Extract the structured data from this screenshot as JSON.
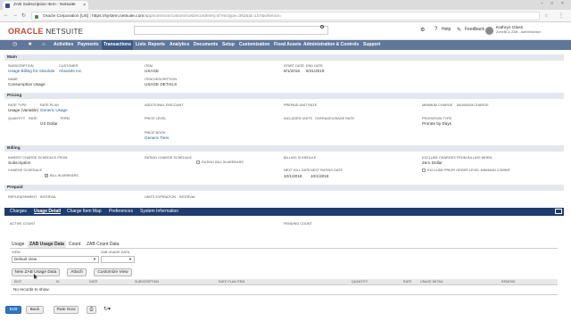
{
  "browser": {
    "tab_title": "ZAB Subscription Item - Netsuite",
    "tab_close": "×",
    "window_min": "–",
    "window_max": "□",
    "window_close": "×",
    "back": "←",
    "forward": "→",
    "reload": "↻",
    "url_org": "Oracle Corporation [US]",
    "url_sep": "|",
    "url_host": "https://system.netsuite.com",
    "url_path": "/app/common/custom/custrecordentry.nl?rectype=362&id=107&whence="
  },
  "header": {
    "logo_main": "ORACLE",
    "logo_sub": " NETSUITE",
    "help": "Help",
    "feedback": "Feedback",
    "user_name": "Kathryn Glass",
    "user_role": "ZoneBCo ZAB - Administrator"
  },
  "topnav": [
    "Activities",
    "Payments",
    "Transactions",
    "Lists",
    "Reports",
    "Analytics",
    "Documents",
    "Setup",
    "Customization",
    "Fixed Assets",
    "Administration & Controls",
    "Support"
  ],
  "sections": {
    "main": "Main",
    "pricing": "Pricing",
    "billing": "Billing",
    "prepaid": "Prepaid"
  },
  "main": {
    "subscription_label": "Subscription",
    "subscription_value": "Usage Billing for Absolute",
    "customer_label": "Customer",
    "customer_value": "Absolute Inc.",
    "item_label": "Item",
    "item_value": "USAGE",
    "start_date_label": "Start Date",
    "start_date_value": "9/1/2018",
    "end_date_label": "End Date",
    "end_date_value": "8/31/2019",
    "name_label": "Name",
    "name_value": "Consumption Usage",
    "item_description_label": "Item Description",
    "item_description_value": "USAGE DETAILS"
  },
  "pricing": {
    "rate_type_label": "Rate Type",
    "rate_type_value": "Usage (Variable)",
    "rate_plan_label": "Rate Plan",
    "rate_plan_value": "Generic Usage",
    "additional_discount_label": "Additional Discount",
    "prepaid_unit_rate_label": "Prepaid Unit Rate",
    "minimum_charge_label": "Minimum Charge",
    "maximum_charge_label": "Maximum Charge",
    "quantity_label": "Quantity",
    "rate_label": "Rate",
    "term_label": "Term",
    "price_level_label": "Price Level",
    "included_units_label": "Included Units",
    "overage_usage_rate_label": "Overage/Usage Rate",
    "proration_type_label": "Proration Type",
    "proration_type_value": "Prorate by Days",
    "currency_value": "US Dollar",
    "price_book_label": "Price Book",
    "price_book_value": "Generic Tiers"
  },
  "billing": {
    "inherit_label": "Inherit Charge Schedule From",
    "inherit_value": "Subscription",
    "rating_schedule_label": "Rating Charge Schedule",
    "rating_in_arrears_label": "Rating Bill In Arrears",
    "billing_schedule_label": "Billing Schedule",
    "exclude_charges_label": "Exclude Charges From Billing When",
    "exclude_charges_value": "Zero Dollar",
    "charge_schedule_label": "Charge Schedule",
    "bill_in_arrears_label": "Bill In Arrears",
    "next_bill_date_label": "Next Bill Date",
    "next_bill_date_value": "10/1/2018",
    "next_rating_date_label": "Next Rating Date",
    "next_rating_date_value": "10/1/2018",
    "exclude_prior_label": "Exclude Prior Order Level Minimum Commit"
  },
  "prepaid": {
    "replenishment_label": "Replenishment",
    "replenishment_value": "Interval",
    "units_expiration_label": "Units Expiration",
    "units_expiration_value": "Interval"
  },
  "subtabs": [
    "Charges",
    "Usage Detail",
    "Charge Item Map",
    "Preferences",
    "System Information"
  ],
  "usage_detail": {
    "active_count_label": "Active Count",
    "pending_count_label": "Pending Count",
    "inner_tabs": [
      "Usage",
      "ZAB Usage Data",
      "Count",
      "ZAB Count Data"
    ],
    "view_label": "View",
    "view_value": "Default View",
    "zab_usage_data_label": "ZAB Usage Data",
    "buttons": {
      "new": "New ZAB Usage Data",
      "attach": "Attach",
      "customize": "Customize View"
    },
    "columns": [
      "Edit",
      "ID",
      "Date",
      "Subscription",
      "Rate Plan Item",
      "Quantity",
      "Rate",
      "Usage Detail",
      "Remove"
    ],
    "empty_message": "No records to show."
  },
  "footer": {
    "edit": "Edit",
    "back": "Back",
    "rate_now": "Rate Now"
  }
}
